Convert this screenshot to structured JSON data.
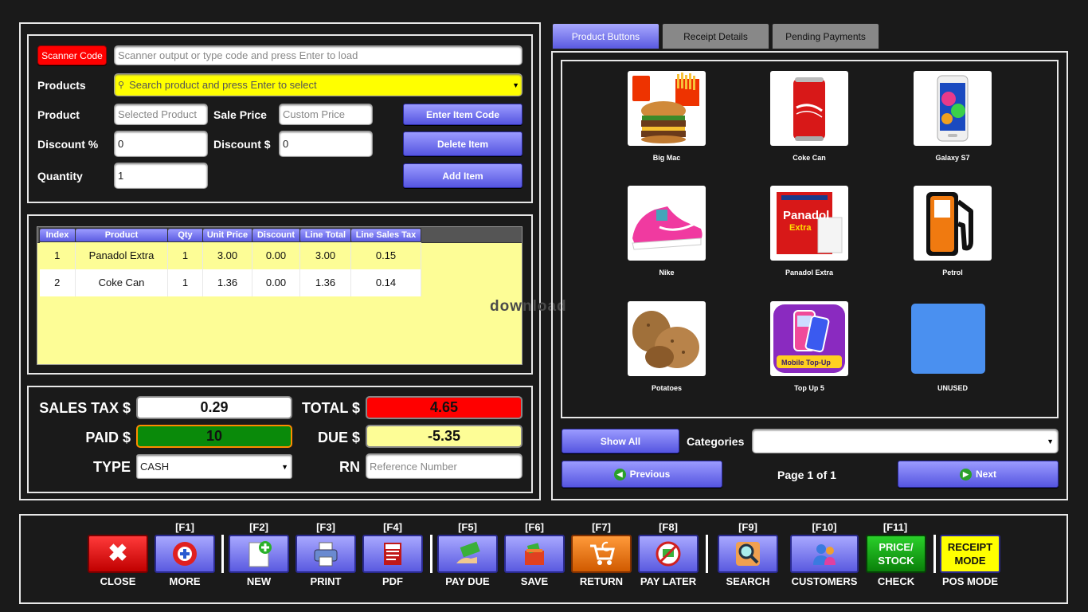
{
  "form": {
    "scanner_label": "Scanner Code",
    "scanner_placeholder": "Scanner output or type code and press Enter to load",
    "products_label": "Products",
    "products_placeholder": "Search product and press Enter to select",
    "product_label": "Product",
    "product_placeholder": "Selected Product",
    "sale_price_label": "Sale Price",
    "sale_price_placeholder": "Custom Price",
    "discount_pct_label": "Discount %",
    "discount_pct_value": "0",
    "discount_amt_label": "Discount $",
    "discount_amt_value": "0",
    "quantity_label": "Quantity",
    "quantity_value": "1",
    "enter_item_code": "Enter Item Code",
    "delete_item": "Delete Item",
    "add_item": "Add Item"
  },
  "grid": {
    "headers": [
      "Index",
      "Product",
      "Qty",
      "Unit Price",
      "Discount",
      "Line Total",
      "Line Sales Tax"
    ],
    "rows": [
      [
        "1",
        "Panadol Extra",
        "1",
        "3.00",
        "0.00",
        "3.00",
        "0.15"
      ],
      [
        "2",
        "Coke Can",
        "1",
        "1.36",
        "0.00",
        "1.36",
        "0.14"
      ]
    ]
  },
  "watermark": "download",
  "totals": {
    "sales_tax_label": "SALES TAX $",
    "sales_tax": "0.29",
    "total_label": "TOTAL $",
    "total": "4.65",
    "paid_label": "PAID $",
    "paid": "10",
    "due_label": "DUE $",
    "due": "-5.35",
    "type_label": "TYPE",
    "type": "CASH",
    "rn_label": "RN",
    "rn_placeholder": "Reference Number"
  },
  "tabs": [
    "Product Buttons",
    "Receipt Details",
    "Pending Payments"
  ],
  "products": [
    "Big Mac",
    "Coke Can",
    "Galaxy S7",
    "Nike",
    "Panadol Extra",
    "Petrol",
    "Potatoes",
    "Top Up 5",
    "UNUSED"
  ],
  "product_image_text": {
    "panadol": "Panadol",
    "extra": "Extra",
    "topup": "Mobile Top-Up"
  },
  "nav": {
    "show_all": "Show All",
    "categories": "Categories",
    "previous": "Previous",
    "page": "Page 1 of 1",
    "next": "Next"
  },
  "toolbar": [
    {
      "key": "",
      "label": "CLOSE"
    },
    {
      "key": "[F1]",
      "label": "MORE"
    },
    {
      "key": "[F2]",
      "label": "NEW"
    },
    {
      "key": "[F3]",
      "label": "PRINT"
    },
    {
      "key": "[F4]",
      "label": "PDF"
    },
    {
      "key": "[F5]",
      "label": "PAY DUE"
    },
    {
      "key": "[F6]",
      "label": "SAVE"
    },
    {
      "key": "[F7]",
      "label": "RETURN"
    },
    {
      "key": "[F8]",
      "label": "PAY LATER"
    },
    {
      "key": "[F9]",
      "label": "SEARCH"
    },
    {
      "key": "[F10]",
      "label": "CUSTOMERS"
    },
    {
      "key": "[F11]",
      "label": "CHECK"
    },
    {
      "key": "",
      "label": "POS MODE"
    }
  ],
  "price_stock_text": "PRICE/ STOCK",
  "receipt_mode_text": "RECEIPT MODE",
  "colors": {
    "accent": "#5a5ae0",
    "total_bg": "#ff0000",
    "paid_bg": "#0a8a0a",
    "due_bg": "#fdfd96",
    "search_bg": "#ffff00",
    "scanner_btn": "#ff0000"
  }
}
